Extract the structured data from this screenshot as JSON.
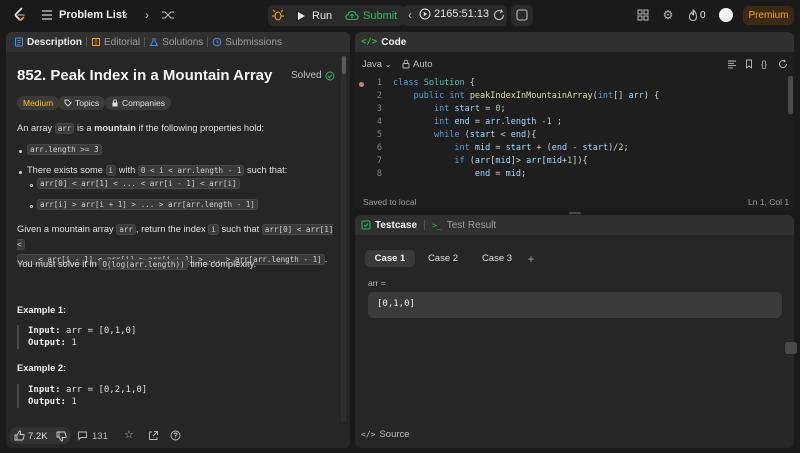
{
  "topbar": {
    "problem_list": "Problem List",
    "run": "Run",
    "submit": "Submit",
    "timer": "2165:51:13",
    "streak": "0",
    "premium": "Premium"
  },
  "left": {
    "tabs": [
      "Description",
      "Editorial",
      "Solutions",
      "Submissions"
    ],
    "title": "852. Peak Index in a Mountain Array",
    "solved": "Solved",
    "difficulty": "Medium",
    "topics": "Topics",
    "companies": "Companies",
    "desc_pre": "An array ",
    "desc_arr": "arr",
    "desc_mid": " is a ",
    "desc_bold": "mountain",
    "desc_post": " if the following properties hold:",
    "bullet1": "arr.length >= 3",
    "bullet2_pre": "There exists some ",
    "bullet2_i": "i",
    "bullet2_with": " with ",
    "bullet2_cond": "0 < i < arr.length - 1",
    "bullet2_post": " such that:",
    "sub1": "arr[0] < arr[1] < ... < arr[i - 1] < arr[i]",
    "sub2": "arr[i] > arr[i + 1] > ... > arr[arr.length - 1]",
    "given_pre": "Given a mountain array ",
    "given_arr": "arr",
    "given_mid": ", return the index ",
    "given_i": "i",
    "given_post": " such that ",
    "given_code1": "arr[0] < arr[1] <",
    "given_code2": "... < arr[i - 1] < arr[i] > arr[i + 1] > ... > arr[arr.length - 1]",
    "given_end": ".",
    "solve_pre": "You must solve it in ",
    "solve_code": "O(log(arr.length))",
    "solve_post": " time complexity.",
    "ex1_title": "Example 1:",
    "ex1_input_label": "Input:",
    "ex1_input": "arr = [0,1,0]",
    "ex1_output_label": "Output:",
    "ex1_output": "1",
    "ex2_title": "Example 2:",
    "ex2_input_label": "Input:",
    "ex2_input": "arr = [0,2,1,0]",
    "ex2_output_label": "Output:",
    "ex2_output": "1",
    "likes": "7.2K",
    "comments": "131"
  },
  "code": {
    "header": "Code",
    "language": "Java",
    "auto": "Auto",
    "saved": "Saved to local",
    "position": "Ln 1, Col 1",
    "line_numbers": [
      "1",
      "2",
      "3",
      "4",
      "5",
      "6",
      "7",
      "8"
    ]
  },
  "test": {
    "tab_testcase": "Testcase",
    "tab_result": "Test Result",
    "cases": [
      "Case 1",
      "Case 2",
      "Case 3"
    ],
    "add": "+",
    "input_label": "arr =",
    "input_value": "[0,1,0]",
    "source": "Source"
  },
  "colors": {
    "accent_orange": "#ffa116",
    "accent_green": "#2cbb5d",
    "medium": "#ffc01e"
  }
}
